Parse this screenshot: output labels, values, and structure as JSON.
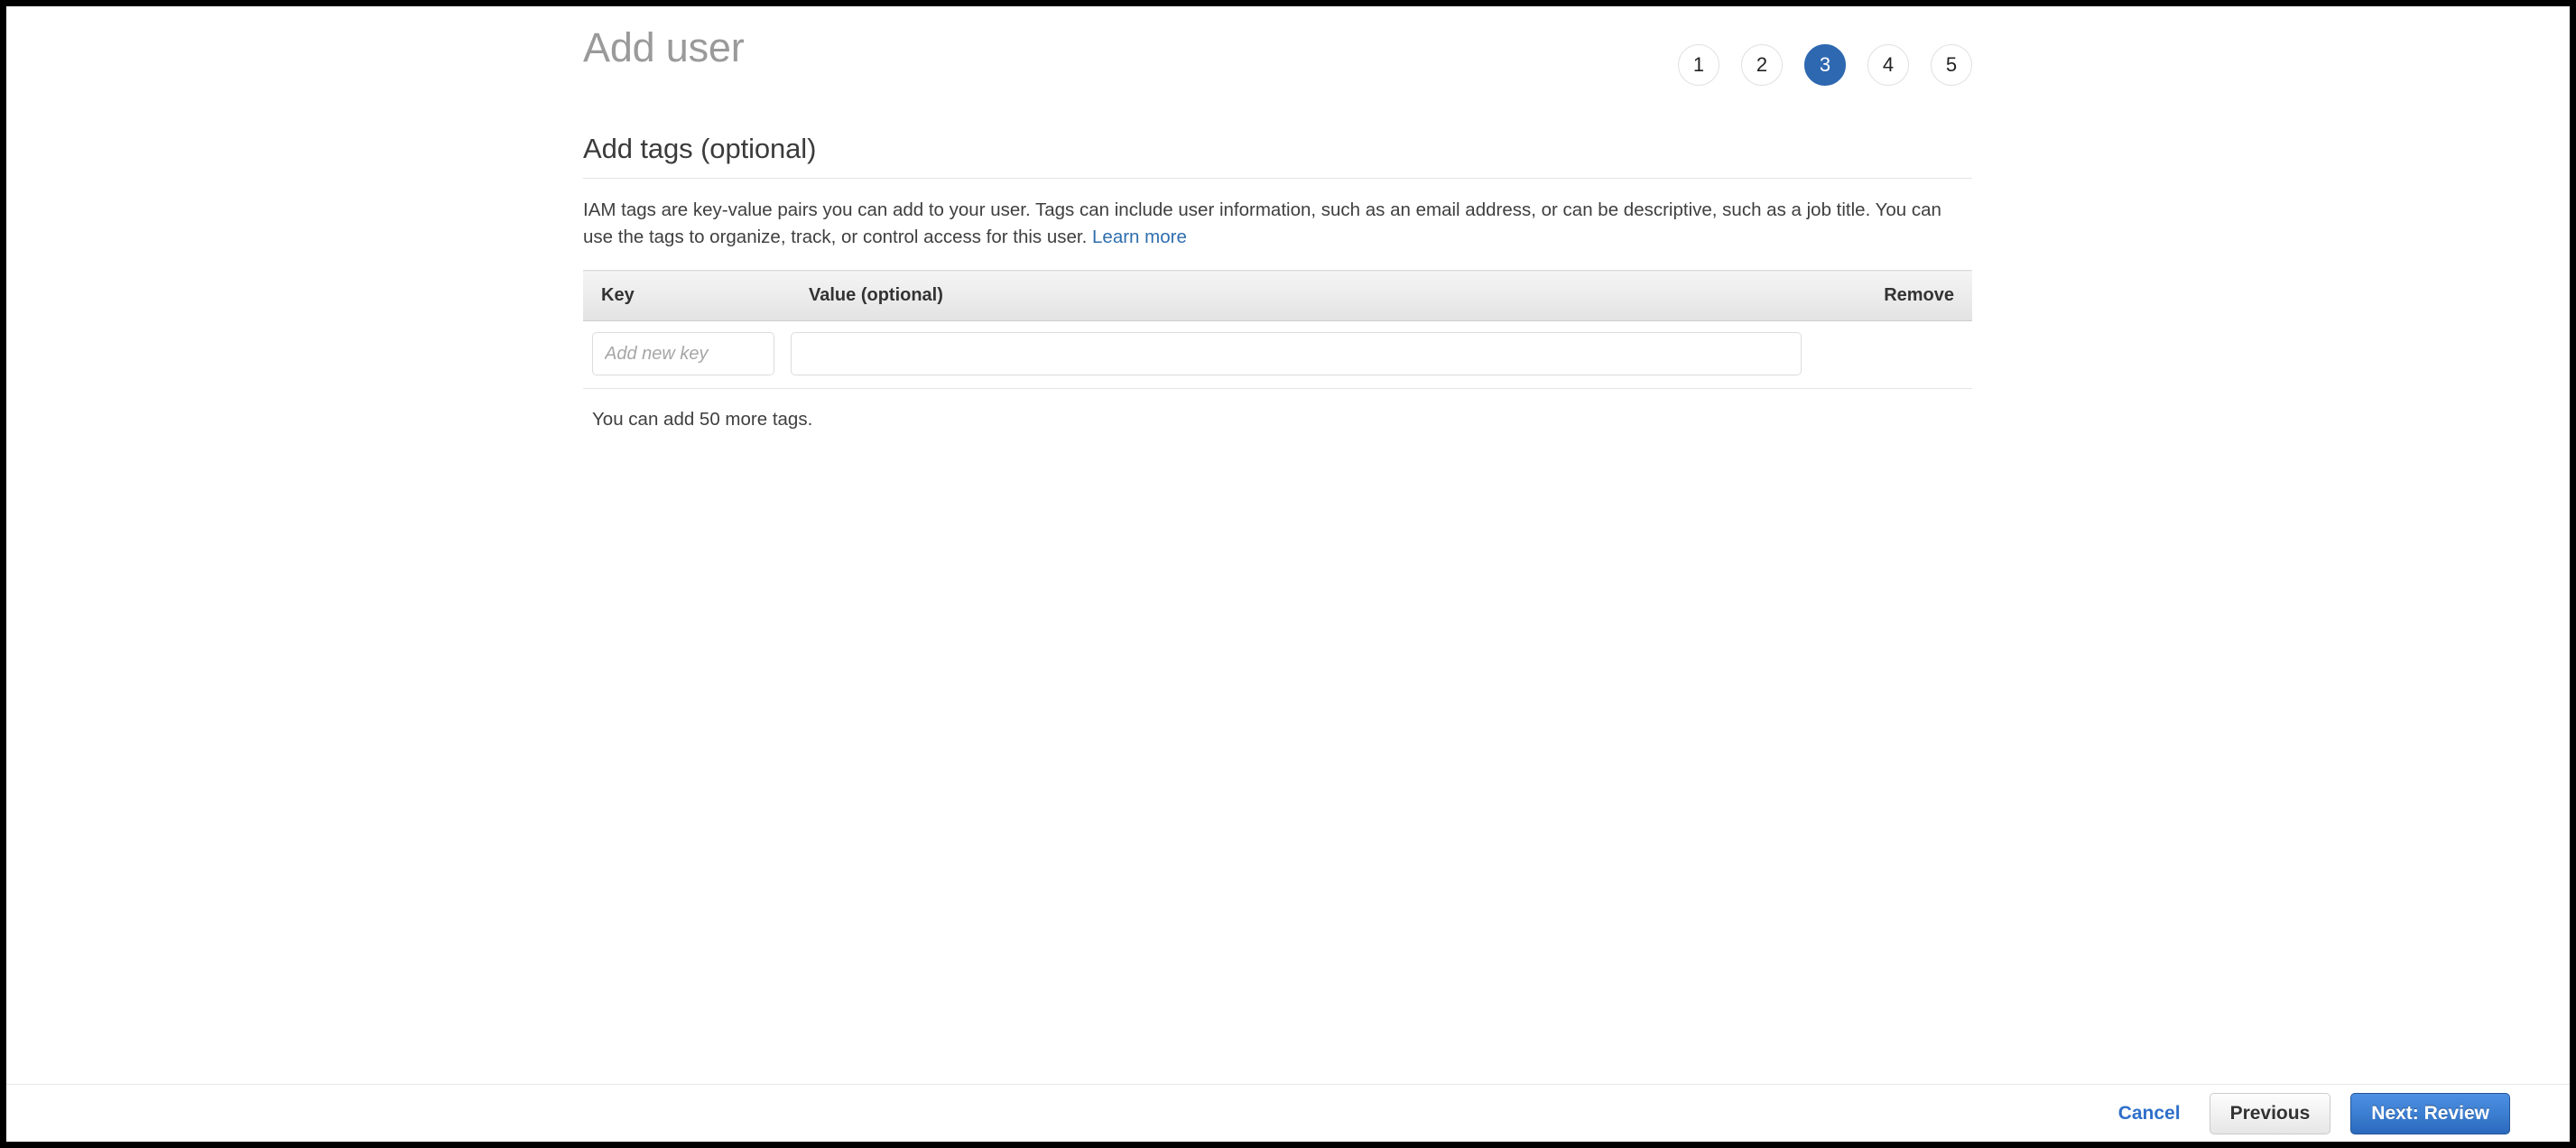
{
  "header": {
    "title": "Add user",
    "steps": [
      {
        "label": "1",
        "active": false
      },
      {
        "label": "2",
        "active": false
      },
      {
        "label": "3",
        "active": true
      },
      {
        "label": "4",
        "active": false
      },
      {
        "label": "5",
        "active": false
      }
    ],
    "active_step": 3,
    "active_step_color": "#2e68b0"
  },
  "section": {
    "title": "Add tags (optional)",
    "description_part1": "IAM tags are key-value pairs you can add to your user. Tags can include user information, such as an email address, or can be descriptive, such as a job title. You can use the tags to organize, track, or control access for this user.",
    "learn_more_label": "Learn more",
    "learn_more_color": "#2e6ead"
  },
  "tags_table": {
    "columns": [
      {
        "label": "Key",
        "align": "left"
      },
      {
        "label": "Value (optional)",
        "align": "left"
      },
      {
        "label": "Remove",
        "align": "right"
      }
    ],
    "rows": [
      {
        "key_value": "",
        "key_placeholder": "Add new key",
        "value_value": "",
        "value_placeholder": "",
        "remove_label": ""
      }
    ],
    "more_tags_text": "You can add 50 more tags."
  },
  "footer": {
    "cancel_label": "Cancel",
    "previous_label": "Previous",
    "next_label": "Next: Review",
    "cancel_color": "#2f6fc9",
    "next_color": "#3d7fd2"
  }
}
